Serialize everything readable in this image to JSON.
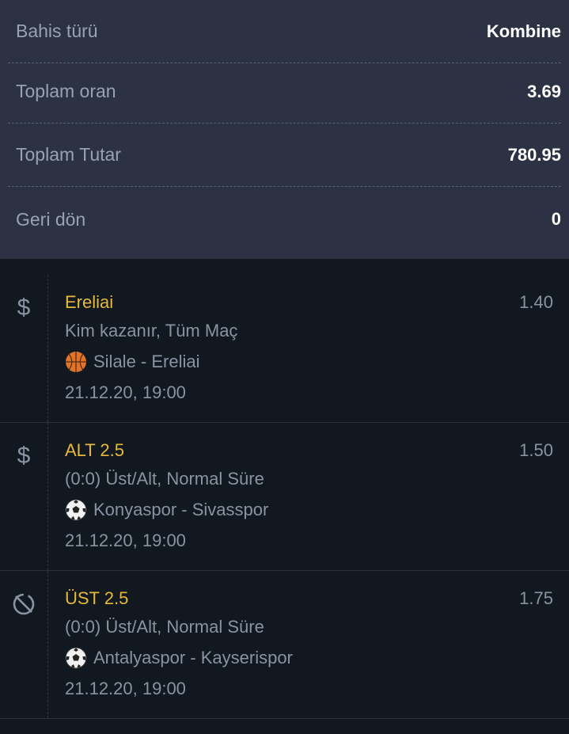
{
  "summary": {
    "bet_type": {
      "label": "Bahis türü",
      "value": "Kombine"
    },
    "total_odds": {
      "label": "Toplam oran",
      "value": "3.69"
    },
    "total_amount": {
      "label": "Toplam Tutar",
      "value": "780.95"
    },
    "return": {
      "label": "Geri dön",
      "value": "0"
    }
  },
  "bets": [
    {
      "status_icon": "dollar-icon",
      "selection": "Ereliai",
      "odd": "1.40",
      "market": "Kim kazanır, Tüm Maç",
      "sport_icon": "basketball-icon",
      "match": "Silale - Ereliai",
      "date": "21.12.20, 19:00"
    },
    {
      "status_icon": "dollar-icon",
      "selection": "ALT 2.5",
      "odd": "1.50",
      "market": "(0:0) Üst/Alt, Normal Süre",
      "sport_icon": "football-icon",
      "match": "Konyaspor - Sivasspor",
      "date": "21.12.20, 19:00"
    },
    {
      "status_icon": "blocked-icon",
      "selection": "ÜST 2.5",
      "odd": "1.75",
      "market": "(0:0) Üst/Alt, Normal Süre",
      "sport_icon": "football-icon",
      "match": "Antalyaspor - Kayserispor",
      "date": "21.12.20, 19:00"
    }
  ],
  "colors": {
    "summary_bg": "#2c3244",
    "list_bg": "#111820",
    "selection": "#e6b93a",
    "muted_text": "#8b93a2"
  }
}
